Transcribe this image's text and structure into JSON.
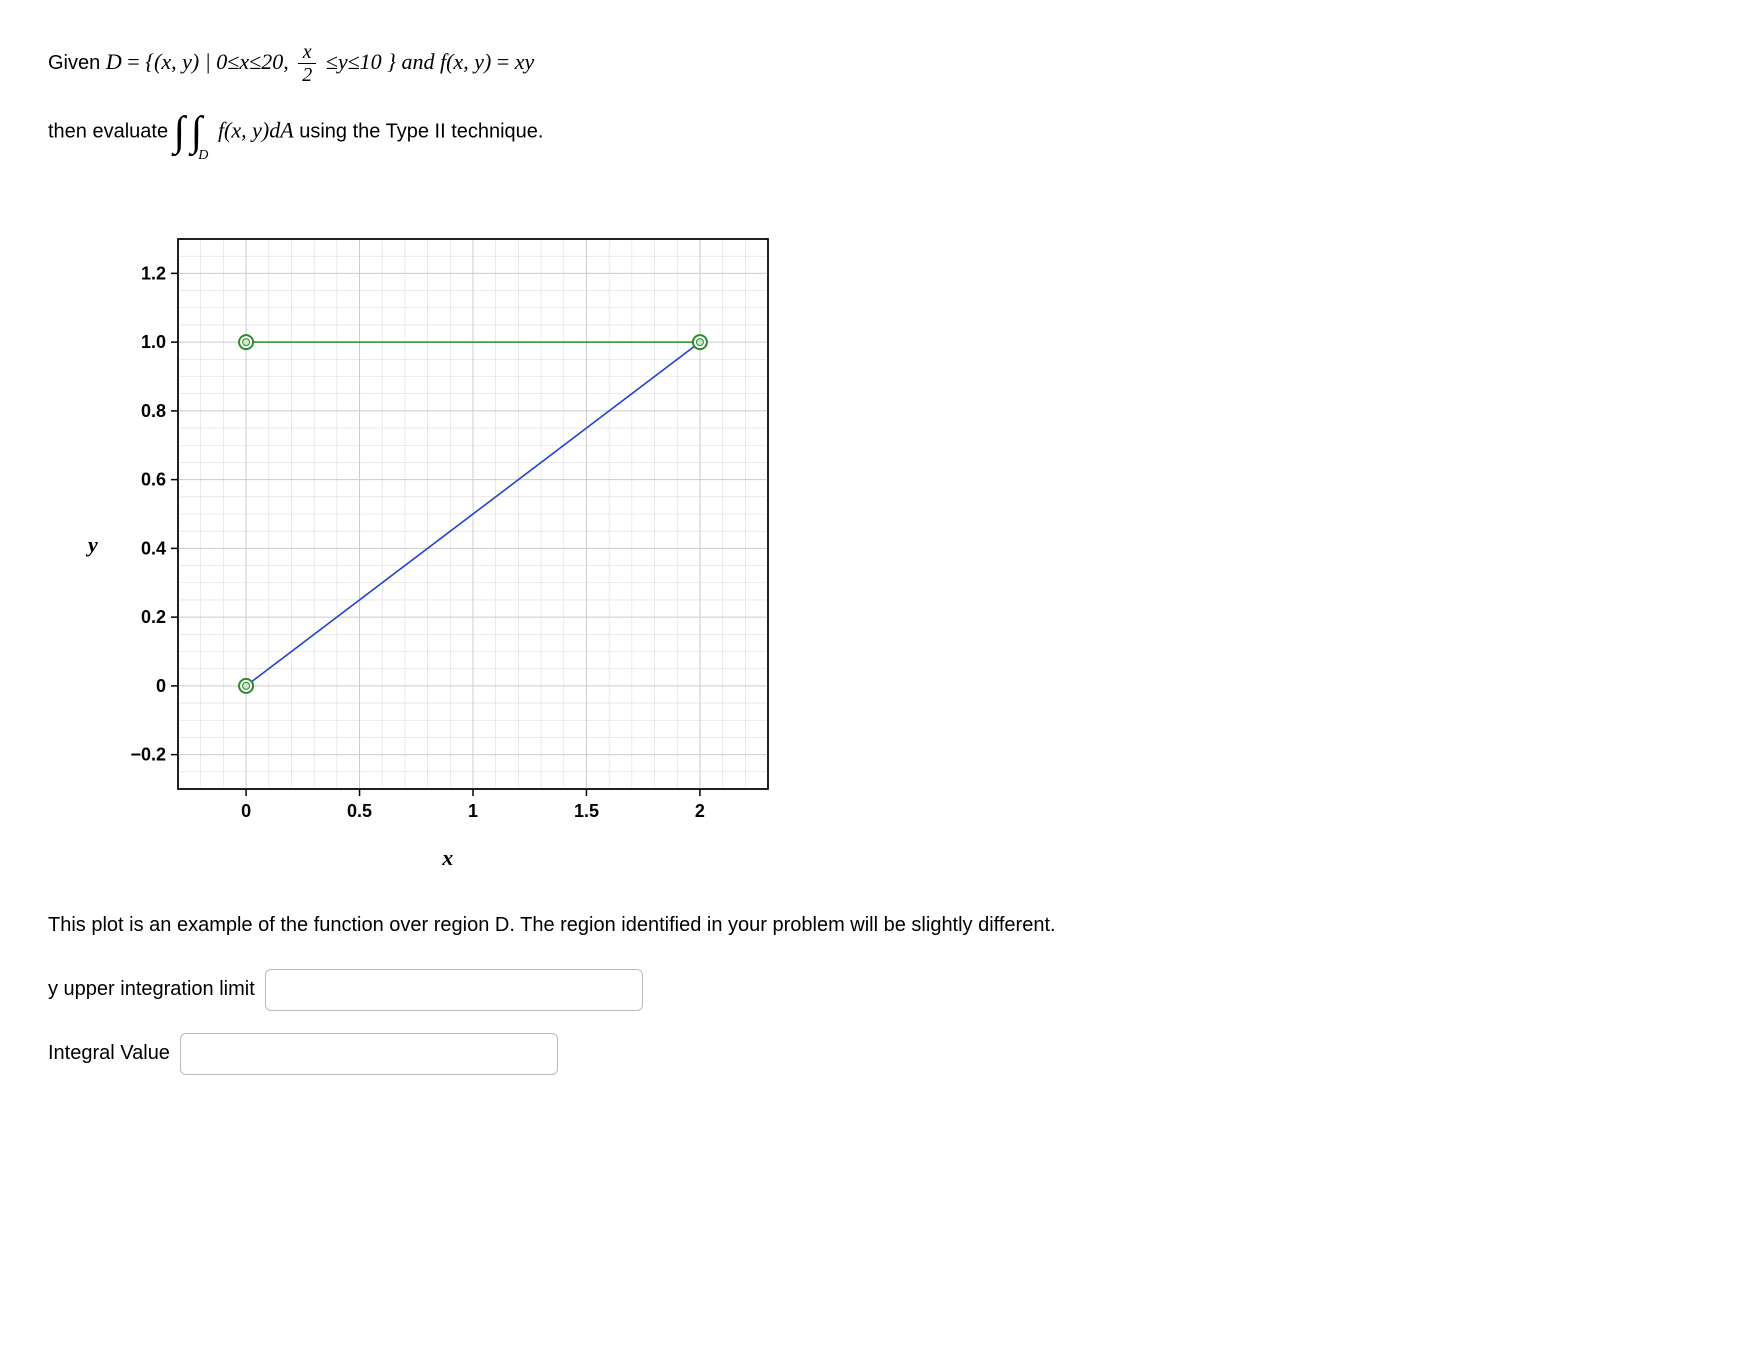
{
  "problem": {
    "line1_prefix": "Given ",
    "D": "D",
    "eq": "=",
    "set_open": "{(x, y) | 0≤x≤20, ",
    "frac_num": "x",
    "frac_den": "2",
    "set_close": "≤y≤10 } and ",
    "fxy": "f(x, y)",
    "eq2": " = ",
    "xy": "xy",
    "line2_prefix": "then evaluate ",
    "int_sub": "D",
    "integrand": "f(x, y)dA",
    "line2_suffix": " using the Type II technique."
  },
  "chart_data": {
    "type": "line",
    "xlabel": "x",
    "ylabel": "y",
    "xlim": [
      -0.3,
      2.3
    ],
    "ylim": [
      -0.3,
      1.3
    ],
    "xticks": [
      0,
      0.5,
      1,
      1.5,
      2
    ],
    "yticks": [
      -0.2,
      0,
      0.2,
      0.4,
      0.6,
      0.8,
      1.0,
      1.2
    ],
    "series": [
      {
        "name": "upper-boundary",
        "color": "#2a8b2a",
        "points": [
          [
            0,
            1
          ],
          [
            2,
            1
          ]
        ]
      },
      {
        "name": "diagonal-boundary",
        "color": "#2040e0",
        "points": [
          [
            0,
            0
          ],
          [
            2,
            1
          ]
        ]
      }
    ],
    "markers": [
      {
        "x": 0,
        "y": 0,
        "color": "#2a8b2a"
      },
      {
        "x": 0,
        "y": 1,
        "color": "#2a8b2a"
      },
      {
        "x": 2,
        "y": 1,
        "color": "#2a8b2a"
      }
    ]
  },
  "caption": "This plot is an example of the function over region D.  The region identified in your problem will be slightly different.",
  "inputs": {
    "y_upper_label": "y upper integration limit",
    "integral_value_label": "Integral Value"
  }
}
